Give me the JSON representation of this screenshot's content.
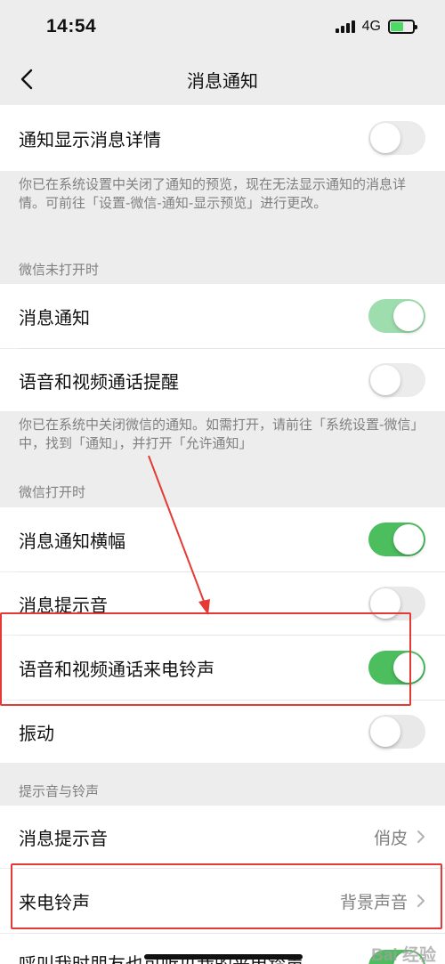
{
  "status_bar": {
    "time": "14:54",
    "network": "4G",
    "icons": [
      "signal-icon",
      "battery-charging-icon"
    ]
  },
  "nav": {
    "title": "消息通知",
    "back_icon": "chevron-left-icon"
  },
  "rows": {
    "show_detail": {
      "label": "通知显示消息详情",
      "on": false
    },
    "msg_notify": {
      "label": "消息通知",
      "on": true
    },
    "voice_video_remind": {
      "label": "语音和视频通话提醒",
      "on": false
    },
    "banner": {
      "label": "消息通知横幅",
      "on": true
    },
    "msg_sound": {
      "label": "消息提示音",
      "on": false
    },
    "call_ringtone_open": {
      "label": "语音和视频通话来电铃声",
      "on": true
    },
    "vibrate": {
      "label": "振动",
      "on": false
    },
    "sound_setting": {
      "label": "消息提示音",
      "value": "俏皮"
    },
    "ringtone_setting": {
      "label": "来电铃声",
      "value": "背景声音"
    },
    "friends_hear": {
      "label": "呼叫我时朋友也可听见我的来电铃声",
      "on": true
    }
  },
  "notes": {
    "preview_off": "你已在系统设置中关闭了通知的预览，现在无法显示通知的消息详情。可前往「设置-微信-通知-显示预览」进行更改。",
    "notify_off": "你已在系统中关闭微信的通知。如需打开，请前往「系统设置-微信」中，找到「通知」，并打开「允许通知」"
  },
  "sections": {
    "not_open": "微信未打开时",
    "open": "微信打开时",
    "sounds": "提示音与铃声"
  },
  "watermark": "Bai 经验",
  "colors": {
    "toggle_on": "#4cbe5e",
    "annotation_red": "#e53935",
    "background": "#ededed"
  }
}
